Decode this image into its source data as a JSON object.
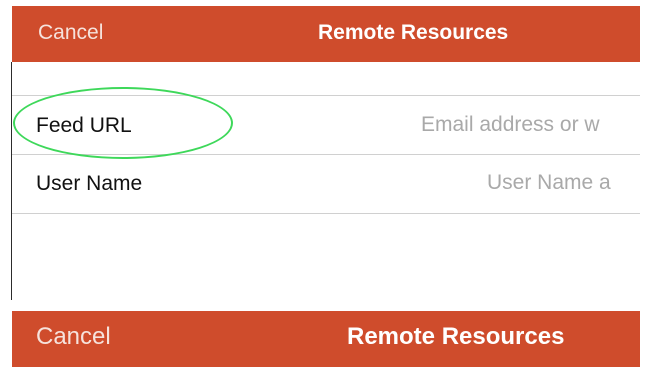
{
  "top_bar": {
    "cancel_label": "Cancel",
    "title": "Remote Resources"
  },
  "form": {
    "rows": [
      {
        "label": "Feed URL",
        "placeholder": "Email address or w"
      },
      {
        "label": "User Name",
        "placeholder": "User Name a"
      }
    ]
  },
  "bottom_bar": {
    "cancel_label": "Cancel",
    "title": "Remote Resources"
  },
  "colors": {
    "nav_background": "#cf4c2c",
    "highlight": "#3ed85a"
  }
}
